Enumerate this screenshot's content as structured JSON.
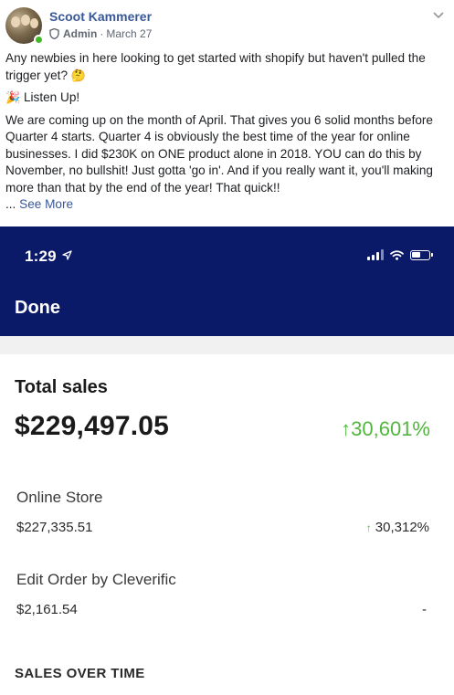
{
  "post": {
    "author": "Scoot Kammerer",
    "role": "Admin",
    "separator": "·",
    "date": "March 27",
    "paragraph1": "Any newbies in here looking to get started with shopify but haven't pulled the trigger yet?",
    "emoji1": "🤔",
    "emoji2": "🎉",
    "listen": "Listen Up!",
    "paragraph2": "We are coming up on the month of April. That gives you 6 solid months before Quarter 4 starts. Quarter 4 is obviously the best time of the year for online businesses. I did $230K on ONE product alone in 2018. YOU can do this by November, no bullshit! Just gotta 'go in'. And if you really want it, you'll making more than that by the end of the year! That quick!!",
    "ellipsis": "...",
    "see_more": "See More"
  },
  "screenshot": {
    "time": "1:29",
    "done": "Done",
    "total_label": "Total sales",
    "total_value": "$229,497.05",
    "total_change": "30,601%",
    "arrow": "↑",
    "rows": [
      {
        "label": "Online Store",
        "value": "$227,335.51",
        "change": "30,312%"
      },
      {
        "label": "Edit Order by Cleverific",
        "value": "$2,161.54",
        "change": "-"
      }
    ],
    "section_heading": "SALES OVER TIME"
  },
  "colors": {
    "author_link": "#385898",
    "ios_bar": "#0a1968",
    "positive": "#50b83c"
  }
}
